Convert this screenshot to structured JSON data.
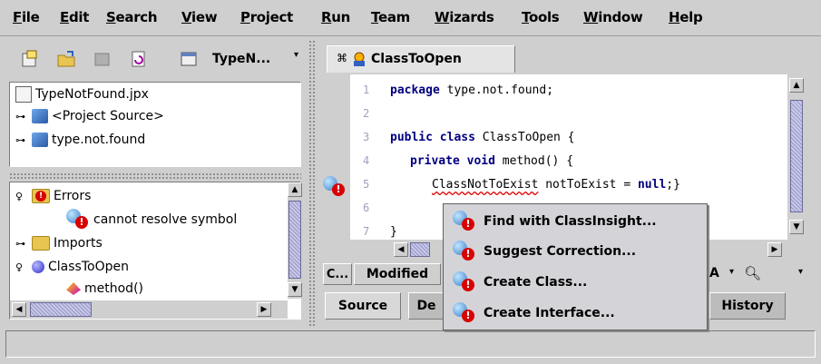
{
  "menubar": {
    "items": [
      {
        "label": "File",
        "mnemonic": "F",
        "rest": "ile"
      },
      {
        "label": "Edit",
        "mnemonic": "E",
        "rest": "dit"
      },
      {
        "label": "Search",
        "mnemonic": "S",
        "rest": "earch"
      },
      {
        "label": "View",
        "mnemonic": "V",
        "rest": "iew"
      },
      {
        "label": "Project",
        "mnemonic": "P",
        "rest": "roject"
      },
      {
        "label": "Run",
        "mnemonic": "R",
        "rest": "un"
      },
      {
        "label": "Team",
        "mnemonic": "T",
        "rest": "eam"
      },
      {
        "label": "Wizards",
        "mnemonic": "W",
        "rest": "izards"
      },
      {
        "label": "Tools",
        "mnemonic": "T",
        "rest": "ools"
      },
      {
        "label": "Window",
        "mnemonic": "W",
        "rest": "indow"
      },
      {
        "label": "Help",
        "mnemonic": "H",
        "rest": "elp"
      }
    ]
  },
  "left_toolbar": {
    "project_combo": "TypeN...",
    "combo_arrow": "▾"
  },
  "project_tree": {
    "items": [
      {
        "label": "TypeNotFound.jpx",
        "icon": "project-file-icon"
      },
      {
        "label": "<Project Source>",
        "icon": "package-icon"
      },
      {
        "label": "type.not.found",
        "icon": "package-icon"
      }
    ]
  },
  "structure": {
    "items": [
      {
        "label": "Errors",
        "icon": "error-folder-icon"
      },
      {
        "label": "cannot resolve symbol",
        "icon": "error-icon"
      },
      {
        "label": "Imports",
        "icon": "imports-folder-icon"
      },
      {
        "label": "ClassToOpen",
        "icon": "class-icon"
      },
      {
        "label": "method()",
        "icon": "method-icon"
      }
    ]
  },
  "editor": {
    "tab_label": "ClassToOpen",
    "line_numbers": [
      "1",
      "2",
      "3",
      "4",
      "5",
      "6",
      "7"
    ],
    "lines": [
      {
        "kw": "package",
        "text": " type.not.found;"
      },
      {
        "kw": "",
        "text": ""
      },
      {
        "kw": "public class",
        "text": " ClassToOpen {"
      },
      {
        "kw": "private void",
        "text": " method() {"
      },
      {
        "pre": "ClassNotToExist",
        "text": " notToExist = ",
        "kw2": "null",
        "post": ";}"
      },
      {
        "kw": "",
        "text": ""
      },
      {
        "kw": "",
        "text": "}"
      }
    ]
  },
  "editor_status": {
    "c_label": "C...",
    "modified": "Modified",
    "insert_mode": "A",
    "zoom_arrow": "▾"
  },
  "bottom_tabs": {
    "source": "Source",
    "design": "De",
    "history": "History"
  },
  "popup": {
    "items": [
      "Find with ClassInsight...",
      "Suggest Correction...",
      "Create Class...",
      "Create Interface..."
    ]
  }
}
